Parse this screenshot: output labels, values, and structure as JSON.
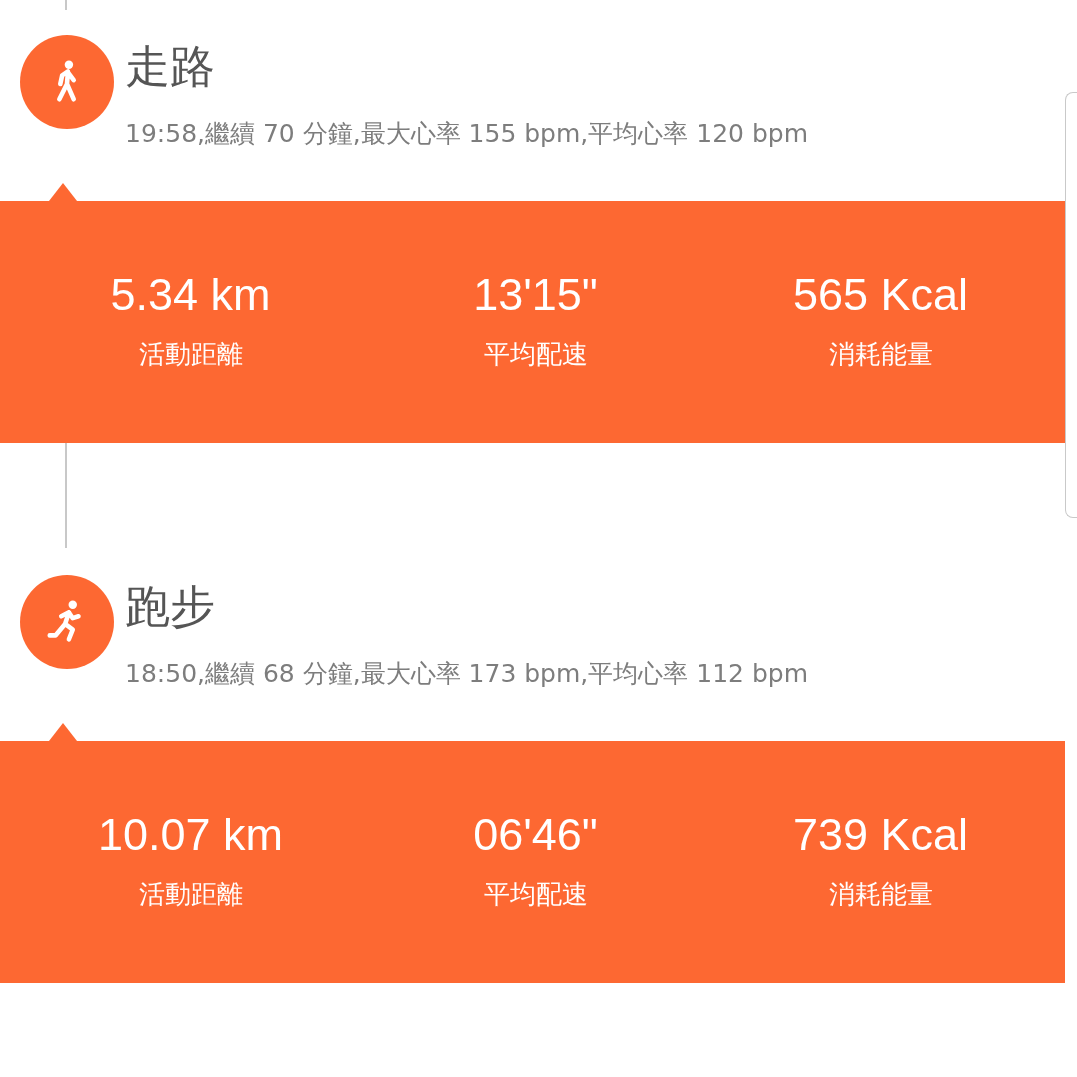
{
  "activities": [
    {
      "kind": "walk",
      "title": "走路",
      "summary": "19:58,繼續 70 分鐘,最大心率 155 bpm,平均心率 120 bpm",
      "stats": [
        {
          "value": "5.34 km",
          "label": "活動距離"
        },
        {
          "value": "13'15\"",
          "label": "平均配速"
        },
        {
          "value": "565 Kcal",
          "label": "消耗能量"
        }
      ]
    },
    {
      "kind": "run",
      "title": "跑步",
      "summary": "18:50,繼續 68 分鐘,最大心率 173 bpm,平均心率 112 bpm",
      "stats": [
        {
          "value": "10.07 km",
          "label": "活動距離"
        },
        {
          "value": "06'46\"",
          "label": "平均配速"
        },
        {
          "value": "739 Kcal",
          "label": "消耗能量"
        }
      ]
    }
  ]
}
